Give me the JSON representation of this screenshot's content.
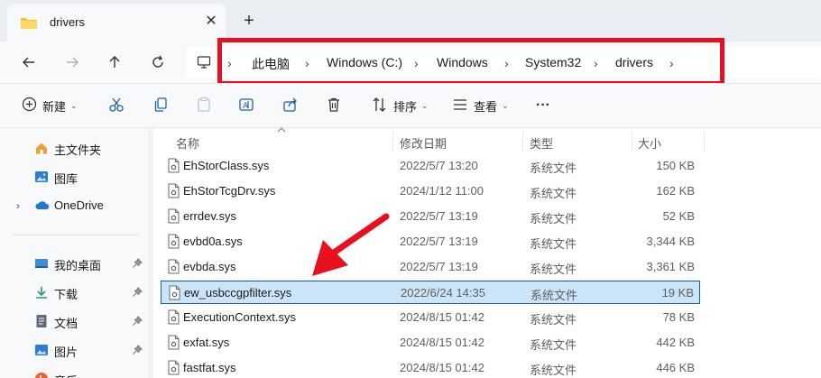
{
  "tab": {
    "title": "drivers",
    "close_glyph": "✕",
    "new_tab_glyph": "+"
  },
  "nav": {
    "back_icon": "arrow-left-icon",
    "forward_icon": "arrow-right-icon",
    "up_icon": "arrow-up-icon",
    "refresh_icon": "refresh-icon"
  },
  "breadcrumb": {
    "root_icon": "computer-icon",
    "items": [
      "此电脑",
      "Windows (C:)",
      "Windows",
      "System32",
      "drivers"
    ],
    "separator": "›"
  },
  "toolbar": {
    "new_label": "新建",
    "sort_label": "排序",
    "view_label": "查看",
    "more_label": "···",
    "caret": "⌄"
  },
  "sidebar": {
    "items": [
      {
        "label": "主文件夹",
        "icon": "home-icon"
      },
      {
        "label": "图库",
        "icon": "gallery-icon"
      },
      {
        "label": "OneDrive",
        "icon": "cloud-icon",
        "expander": "›"
      },
      {
        "label": "我的桌面",
        "icon": "desktop-icon"
      },
      {
        "label": "下载",
        "icon": "download-icon"
      },
      {
        "label": "文档",
        "icon": "document-icon"
      },
      {
        "label": "图片",
        "icon": "pictures-icon"
      },
      {
        "label": "音乐",
        "icon": "music-icon"
      }
    ]
  },
  "columns": {
    "name": "名称",
    "date": "修改日期",
    "type": "类型",
    "size": "大小"
  },
  "files": [
    {
      "name": "EhStorClass.sys",
      "date": "2022/5/7 13:20",
      "type": "系统文件",
      "size": "150 KB"
    },
    {
      "name": "EhStorTcgDrv.sys",
      "date": "2024/1/12 11:00",
      "type": "系统文件",
      "size": "162 KB"
    },
    {
      "name": "errdev.sys",
      "date": "2022/5/7 13:19",
      "type": "系统文件",
      "size": "52 KB"
    },
    {
      "name": "evbd0a.sys",
      "date": "2022/5/7 13:19",
      "type": "系统文件",
      "size": "3,344 KB"
    },
    {
      "name": "evbda.sys",
      "date": "2022/5/7 13:19",
      "type": "系统文件",
      "size": "3,361 KB"
    },
    {
      "name": "ew_usbccgpfilter.sys",
      "date": "2022/6/24 14:35",
      "type": "系统文件",
      "size": "19 KB",
      "selected": true
    },
    {
      "name": "ExecutionContext.sys",
      "date": "2024/8/15 01:42",
      "type": "系统文件",
      "size": "78 KB"
    },
    {
      "name": "exfat.sys",
      "date": "2024/8/15 01:42",
      "type": "系统文件",
      "size": "442 KB"
    },
    {
      "name": "fastfat.sys",
      "date": "2024/8/15 01:42",
      "type": "系统文件",
      "size": "446 KB"
    }
  ],
  "colors": {
    "highlight_red": "#e8101e",
    "selection_bg": "#cce4f7",
    "selection_border": "#0f5da8",
    "folder_yellow": "#f5c33b"
  }
}
